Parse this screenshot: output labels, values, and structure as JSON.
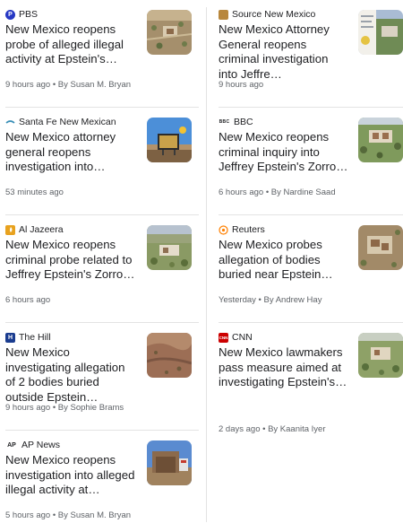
{
  "left_column": [
    {
      "source": "PBS",
      "source_icon": "pbs-logo-icon",
      "headline": "New Mexico reopens probe of alleged illegal activity at Epstein's…",
      "meta": "9 hours ago • By Susan M. Bryan"
    },
    {
      "source": "Santa Fe New Mexican",
      "source_icon": "santa-fe-new-mexican-logo-icon",
      "headline": "New Mexico attorney general reopens investigation into…",
      "meta": "53 minutes ago"
    },
    {
      "source": "Al Jazeera",
      "source_icon": "al-jazeera-logo-icon",
      "headline": "New Mexico reopens criminal probe related to Jeffrey Epstein's Zorro…",
      "meta": "6 hours ago"
    },
    {
      "source": "The Hill",
      "source_icon": "the-hill-logo-icon",
      "headline": "New Mexico investigating allegation of 2 bodies buried outside Epstein…",
      "meta": "9 hours ago • By Sophie Brams"
    },
    {
      "source": "AP News",
      "source_icon": "ap-news-logo-icon",
      "headline": "New Mexico reopens investigation into alleged illegal activity at…",
      "meta": "5 hours ago • By Susan M. Bryan"
    }
  ],
  "right_column": [
    {
      "source": "Source New Mexico",
      "source_icon": "source-new-mexico-logo-icon",
      "headline": "New Mexico Attorney General reopens criminal investigation into Jeffre…",
      "meta": "9 hours ago"
    },
    {
      "source": "BBC",
      "source_icon": "bbc-logo-icon",
      "headline": "New Mexico reopens criminal inquiry into Jeffrey Epstein's Zorro…",
      "meta": "6 hours ago • By Nardine Saad"
    },
    {
      "source": "Reuters",
      "source_icon": "reuters-logo-icon",
      "headline": "New Mexico probes allegation of bodies buried near Epstein…",
      "meta": "Yesterday • By Andrew Hay"
    },
    {
      "source": "CNN",
      "source_icon": "cnn-logo-icon",
      "headline": "New Mexico lawmakers pass measure aimed at investigating Epstein's…",
      "meta": "2 days ago • By Kaanita Iyer"
    }
  ],
  "logo_marks": {
    "pbs": "P",
    "the_hill": "H",
    "ap": "AP",
    "cnn": "CNN",
    "bbc": "BBC"
  },
  "colors": {
    "headline": "#202124",
    "meta": "#5f6368",
    "divider": "#e3e3e3",
    "pbs": "#2638c4",
    "al_jazeera": "#e8a21f",
    "the_hill": "#1a3c8f",
    "cnn": "#cc0000",
    "reuters": "#ff8000",
    "santa_fe": "#3a8fb7"
  }
}
